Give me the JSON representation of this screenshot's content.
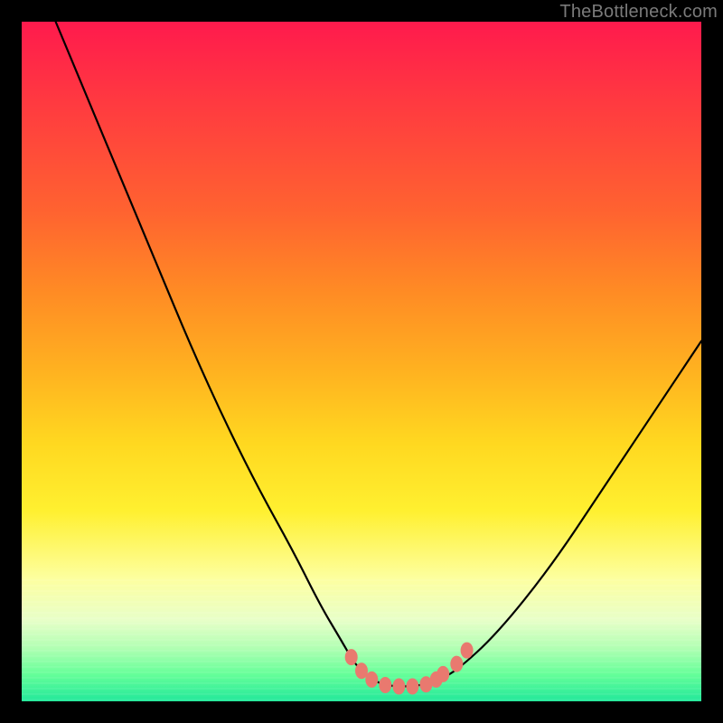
{
  "watermark": "TheBottleneck.com",
  "colors": {
    "frame": "#000000",
    "curve": "#000000",
    "markers": "#e9796f",
    "grad_top": "#ff1a4d",
    "grad_bottom": "#22e89a"
  },
  "chart_data": {
    "type": "line",
    "title": "",
    "xlabel": "",
    "ylabel": "",
    "xlim": [
      0,
      100
    ],
    "ylim": [
      0,
      100
    ],
    "grid": false,
    "series": [
      {
        "name": "bottleneck-curve",
        "x": [
          5,
          10,
          15,
          20,
          25,
          30,
          35,
          40,
          44,
          47,
          49,
          51,
          53,
          55,
          57,
          59,
          61,
          64,
          70,
          78,
          86,
          94,
          100
        ],
        "y": [
          100,
          88,
          76,
          64,
          52,
          41,
          31,
          22,
          14,
          9,
          5.5,
          3.5,
          2.5,
          2.2,
          2.2,
          2.4,
          3,
          4.5,
          10,
          20,
          32,
          44,
          53
        ]
      }
    ],
    "markers": {
      "name": "highlight-dots",
      "color": "#e9796f",
      "points": [
        {
          "x": 48.5,
          "y": 6.5
        },
        {
          "x": 50.0,
          "y": 4.5
        },
        {
          "x": 51.5,
          "y": 3.2
        },
        {
          "x": 53.5,
          "y": 2.4
        },
        {
          "x": 55.5,
          "y": 2.2
        },
        {
          "x": 57.5,
          "y": 2.2
        },
        {
          "x": 59.5,
          "y": 2.5
        },
        {
          "x": 61.0,
          "y": 3.2
        },
        {
          "x": 62.0,
          "y": 4.0
        },
        {
          "x": 64.0,
          "y": 5.5
        },
        {
          "x": 65.5,
          "y": 7.5
        }
      ]
    }
  }
}
